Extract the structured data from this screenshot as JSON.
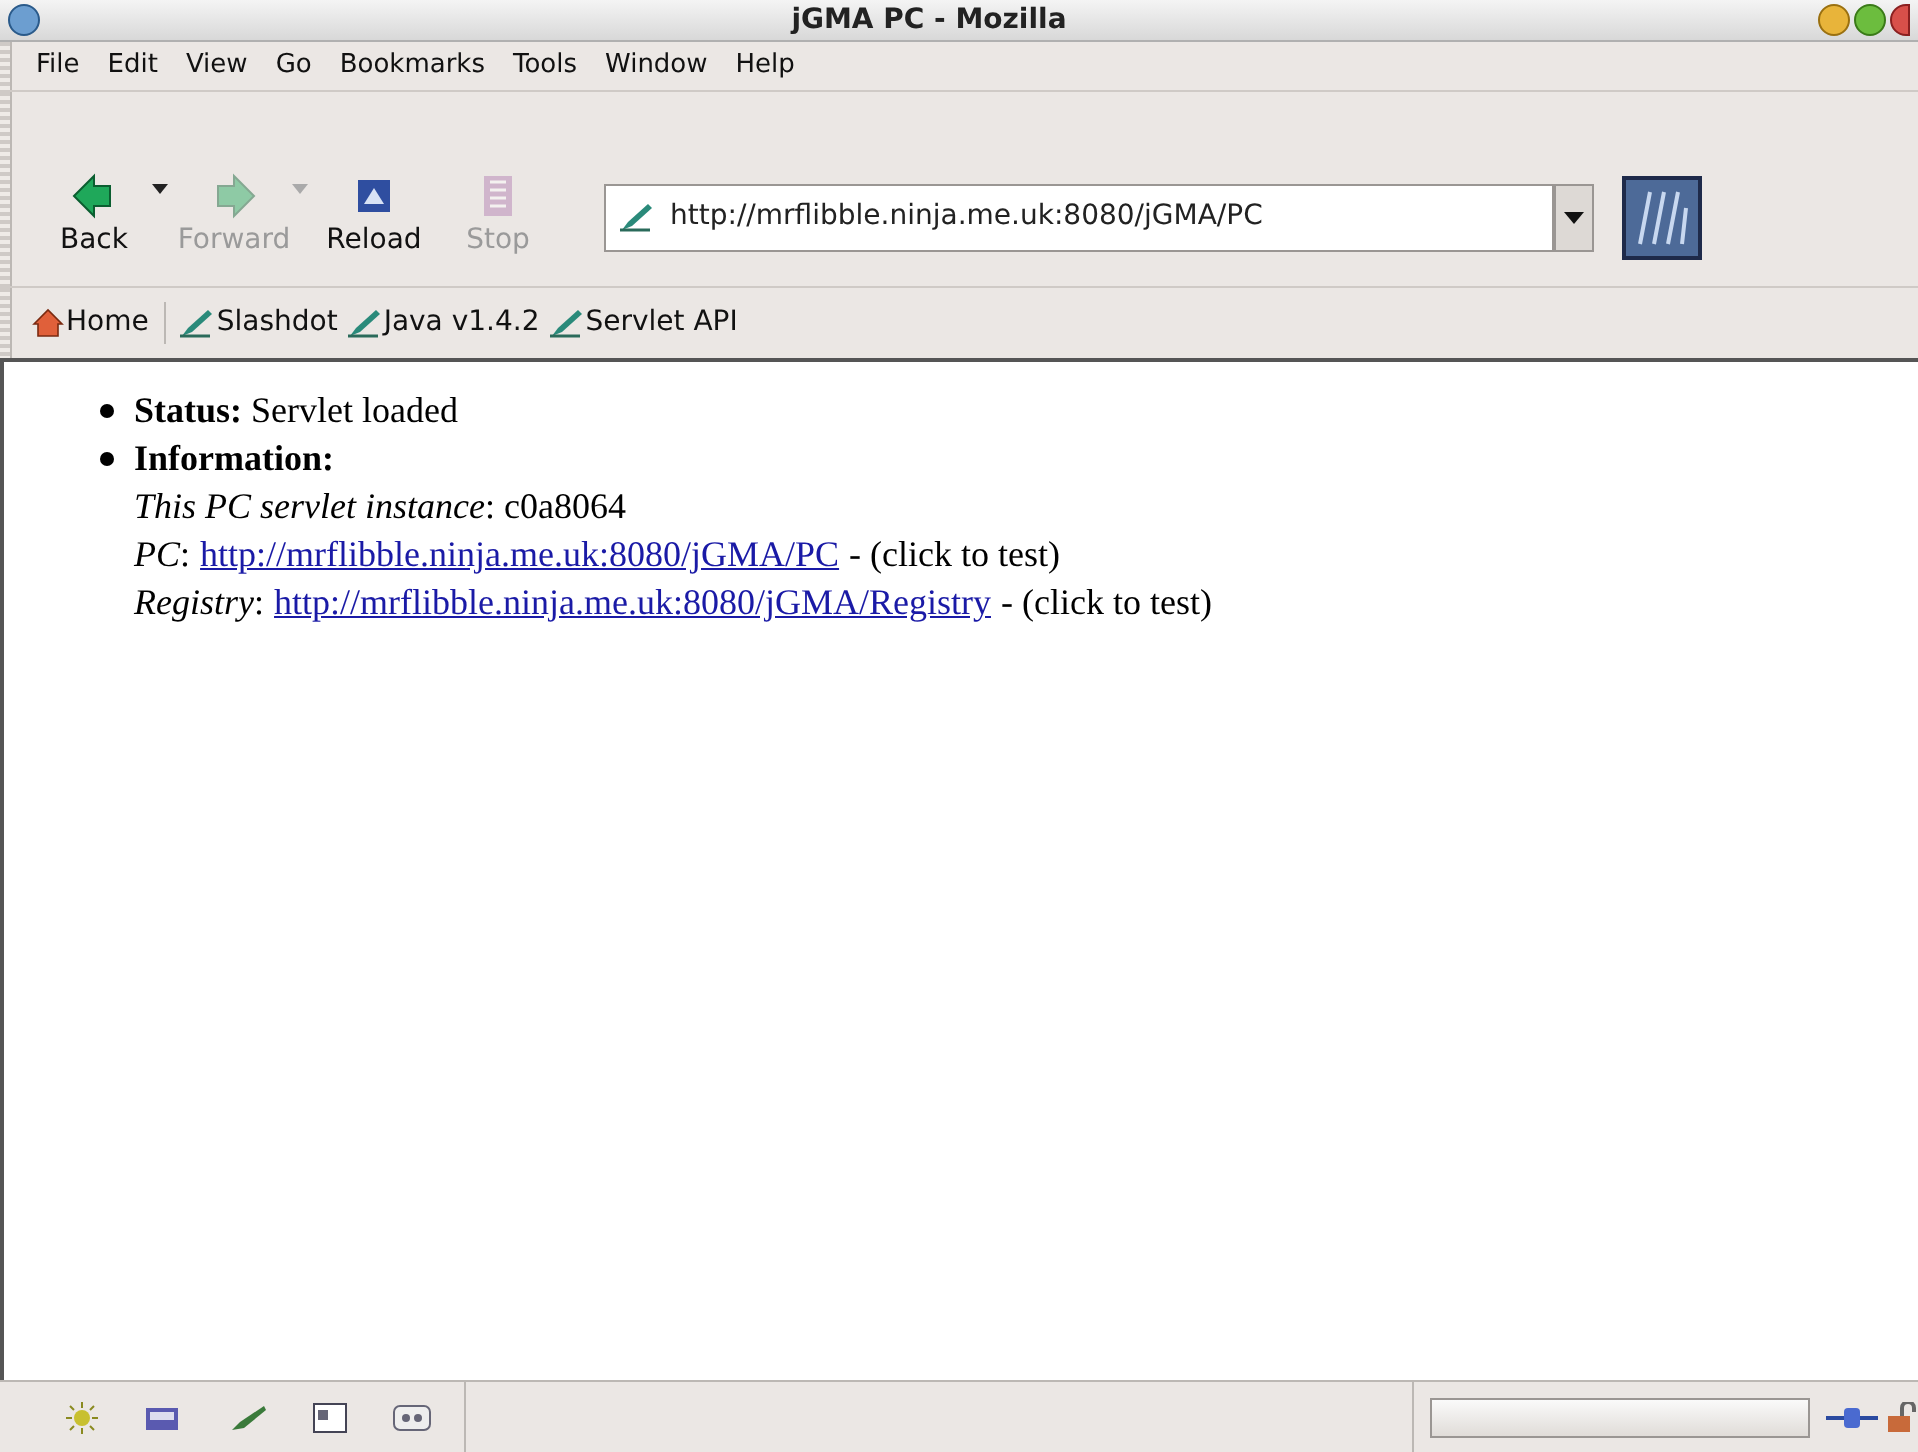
{
  "window": {
    "title": "jGMA PC - Mozilla"
  },
  "menu": [
    "File",
    "Edit",
    "View",
    "Go",
    "Bookmarks",
    "Tools",
    "Window",
    "Help"
  ],
  "nav_buttons": [
    {
      "kind": "back",
      "label": "Back",
      "disabled": false,
      "dropdown": true
    },
    {
      "kind": "forward",
      "label": "Forward",
      "disabled": true,
      "dropdown": true
    },
    {
      "kind": "reload",
      "label": "Reload",
      "disabled": false,
      "dropdown": false
    },
    {
      "kind": "stop",
      "label": "Stop",
      "disabled": true,
      "dropdown": false
    }
  ],
  "address": {
    "value": "http://mrflibble.ninja.me.uk:8080/jGMA/PC"
  },
  "bookmarks": [
    {
      "kind": "home",
      "label": "Home"
    },
    {
      "kind": "link",
      "label": "Slashdot"
    },
    {
      "kind": "link",
      "label": "Java v1.4.2"
    },
    {
      "kind": "link",
      "label": "Servlet API"
    }
  ],
  "content": {
    "items": [
      {
        "label": "Status:",
        "text": "Servlet loaded"
      },
      {
        "label": "Information:"
      }
    ],
    "info_lines": [
      {
        "label": "This PC servlet instance",
        "sep": ":",
        "text": "c0a8064"
      },
      {
        "label": "PC",
        "sep": ":",
        "link": "http://mrflibble.ninja.me.uk:8080/jGMA/PC",
        "text": "- (click to test)"
      },
      {
        "label": "Registry",
        "sep": ":",
        "link": "http://mrflibble.ninja.me.uk:8080/jGMA/Registry",
        "text": "- (click to test)"
      }
    ]
  }
}
